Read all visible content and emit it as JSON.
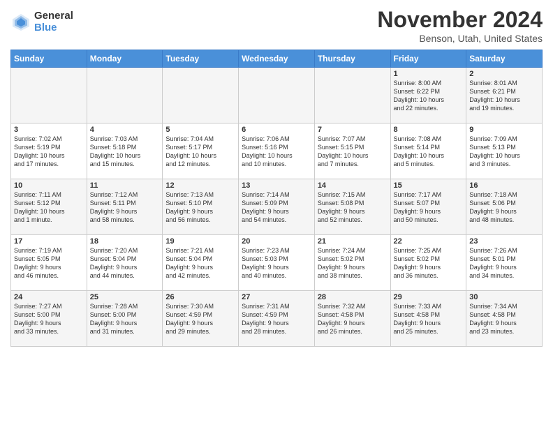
{
  "header": {
    "logo_general": "General",
    "logo_blue": "Blue",
    "title": "November 2024",
    "location": "Benson, Utah, United States"
  },
  "weekdays": [
    "Sunday",
    "Monday",
    "Tuesday",
    "Wednesday",
    "Thursday",
    "Friday",
    "Saturday"
  ],
  "weeks": [
    [
      {
        "day": "",
        "info": ""
      },
      {
        "day": "",
        "info": ""
      },
      {
        "day": "",
        "info": ""
      },
      {
        "day": "",
        "info": ""
      },
      {
        "day": "",
        "info": ""
      },
      {
        "day": "1",
        "info": "Sunrise: 8:00 AM\nSunset: 6:22 PM\nDaylight: 10 hours\nand 22 minutes."
      },
      {
        "day": "2",
        "info": "Sunrise: 8:01 AM\nSunset: 6:21 PM\nDaylight: 10 hours\nand 19 minutes."
      }
    ],
    [
      {
        "day": "3",
        "info": "Sunrise: 7:02 AM\nSunset: 5:19 PM\nDaylight: 10 hours\nand 17 minutes."
      },
      {
        "day": "4",
        "info": "Sunrise: 7:03 AM\nSunset: 5:18 PM\nDaylight: 10 hours\nand 15 minutes."
      },
      {
        "day": "5",
        "info": "Sunrise: 7:04 AM\nSunset: 5:17 PM\nDaylight: 10 hours\nand 12 minutes."
      },
      {
        "day": "6",
        "info": "Sunrise: 7:06 AM\nSunset: 5:16 PM\nDaylight: 10 hours\nand 10 minutes."
      },
      {
        "day": "7",
        "info": "Sunrise: 7:07 AM\nSunset: 5:15 PM\nDaylight: 10 hours\nand 7 minutes."
      },
      {
        "day": "8",
        "info": "Sunrise: 7:08 AM\nSunset: 5:14 PM\nDaylight: 10 hours\nand 5 minutes."
      },
      {
        "day": "9",
        "info": "Sunrise: 7:09 AM\nSunset: 5:13 PM\nDaylight: 10 hours\nand 3 minutes."
      }
    ],
    [
      {
        "day": "10",
        "info": "Sunrise: 7:11 AM\nSunset: 5:12 PM\nDaylight: 10 hours\nand 1 minute."
      },
      {
        "day": "11",
        "info": "Sunrise: 7:12 AM\nSunset: 5:11 PM\nDaylight: 9 hours\nand 58 minutes."
      },
      {
        "day": "12",
        "info": "Sunrise: 7:13 AM\nSunset: 5:10 PM\nDaylight: 9 hours\nand 56 minutes."
      },
      {
        "day": "13",
        "info": "Sunrise: 7:14 AM\nSunset: 5:09 PM\nDaylight: 9 hours\nand 54 minutes."
      },
      {
        "day": "14",
        "info": "Sunrise: 7:15 AM\nSunset: 5:08 PM\nDaylight: 9 hours\nand 52 minutes."
      },
      {
        "day": "15",
        "info": "Sunrise: 7:17 AM\nSunset: 5:07 PM\nDaylight: 9 hours\nand 50 minutes."
      },
      {
        "day": "16",
        "info": "Sunrise: 7:18 AM\nSunset: 5:06 PM\nDaylight: 9 hours\nand 48 minutes."
      }
    ],
    [
      {
        "day": "17",
        "info": "Sunrise: 7:19 AM\nSunset: 5:05 PM\nDaylight: 9 hours\nand 46 minutes."
      },
      {
        "day": "18",
        "info": "Sunrise: 7:20 AM\nSunset: 5:04 PM\nDaylight: 9 hours\nand 44 minutes."
      },
      {
        "day": "19",
        "info": "Sunrise: 7:21 AM\nSunset: 5:04 PM\nDaylight: 9 hours\nand 42 minutes."
      },
      {
        "day": "20",
        "info": "Sunrise: 7:23 AM\nSunset: 5:03 PM\nDaylight: 9 hours\nand 40 minutes."
      },
      {
        "day": "21",
        "info": "Sunrise: 7:24 AM\nSunset: 5:02 PM\nDaylight: 9 hours\nand 38 minutes."
      },
      {
        "day": "22",
        "info": "Sunrise: 7:25 AM\nSunset: 5:02 PM\nDaylight: 9 hours\nand 36 minutes."
      },
      {
        "day": "23",
        "info": "Sunrise: 7:26 AM\nSunset: 5:01 PM\nDaylight: 9 hours\nand 34 minutes."
      }
    ],
    [
      {
        "day": "24",
        "info": "Sunrise: 7:27 AM\nSunset: 5:00 PM\nDaylight: 9 hours\nand 33 minutes."
      },
      {
        "day": "25",
        "info": "Sunrise: 7:28 AM\nSunset: 5:00 PM\nDaylight: 9 hours\nand 31 minutes."
      },
      {
        "day": "26",
        "info": "Sunrise: 7:30 AM\nSunset: 4:59 PM\nDaylight: 9 hours\nand 29 minutes."
      },
      {
        "day": "27",
        "info": "Sunrise: 7:31 AM\nSunset: 4:59 PM\nDaylight: 9 hours\nand 28 minutes."
      },
      {
        "day": "28",
        "info": "Sunrise: 7:32 AM\nSunset: 4:58 PM\nDaylight: 9 hours\nand 26 minutes."
      },
      {
        "day": "29",
        "info": "Sunrise: 7:33 AM\nSunset: 4:58 PM\nDaylight: 9 hours\nand 25 minutes."
      },
      {
        "day": "30",
        "info": "Sunrise: 7:34 AM\nSunset: 4:58 PM\nDaylight: 9 hours\nand 23 minutes."
      }
    ]
  ]
}
